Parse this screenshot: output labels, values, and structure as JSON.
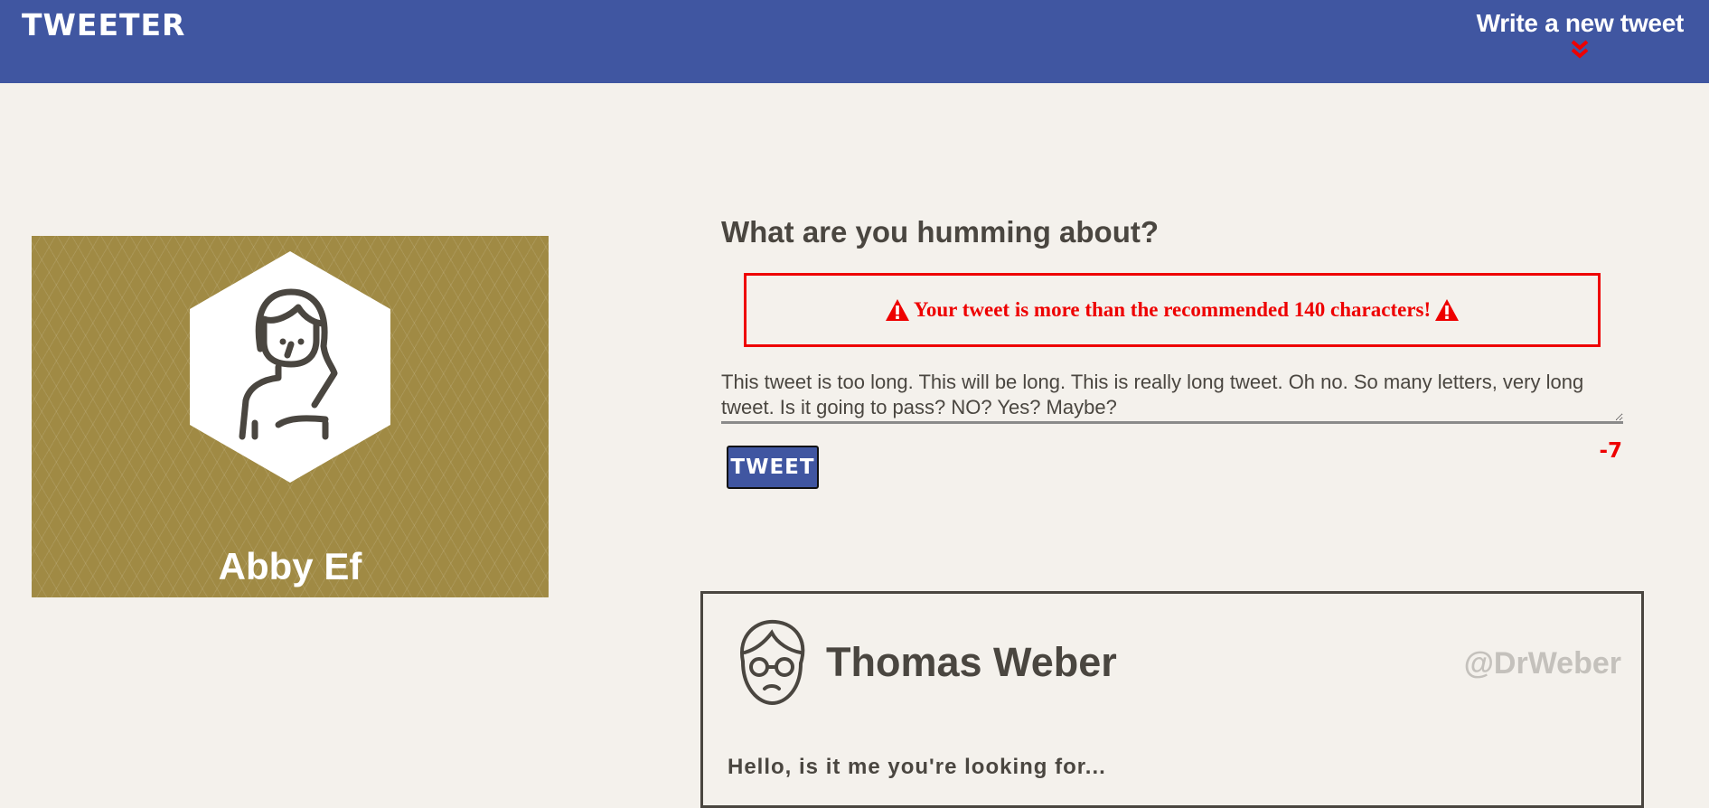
{
  "nav": {
    "logo": "TWEETER",
    "write_link": "Write a new tweet"
  },
  "profile": {
    "name": "Abby Ef"
  },
  "compose": {
    "title": "What are you humming about?",
    "error": "Your tweet is more than the recommended 140 characters!",
    "tweet_text": "This tweet is too long. This will be long. This is really long tweet. Oh no. So many letters, very long tweet. Is it going to pass? NO? Yes? Maybe?",
    "button_label": "TWEET",
    "counter": "-7"
  },
  "tweets": [
    {
      "name": "Thomas Weber",
      "handle": "@DrWeber",
      "text": "Hello, is it me you're looking for..."
    }
  ],
  "colors": {
    "nav_bg": "#4056a1",
    "page_bg": "#f4f1ec",
    "profile_bg": "#a08a44",
    "error": "#ee0000",
    "text": "#4a4640"
  },
  "icons": {
    "write_chevron": "double-chevron-down-icon",
    "warning": "warning-triangle-icon",
    "profile_avatar": "woman-avatar-icon",
    "tweet_avatar": "man-with-glasses-avatar-icon"
  }
}
